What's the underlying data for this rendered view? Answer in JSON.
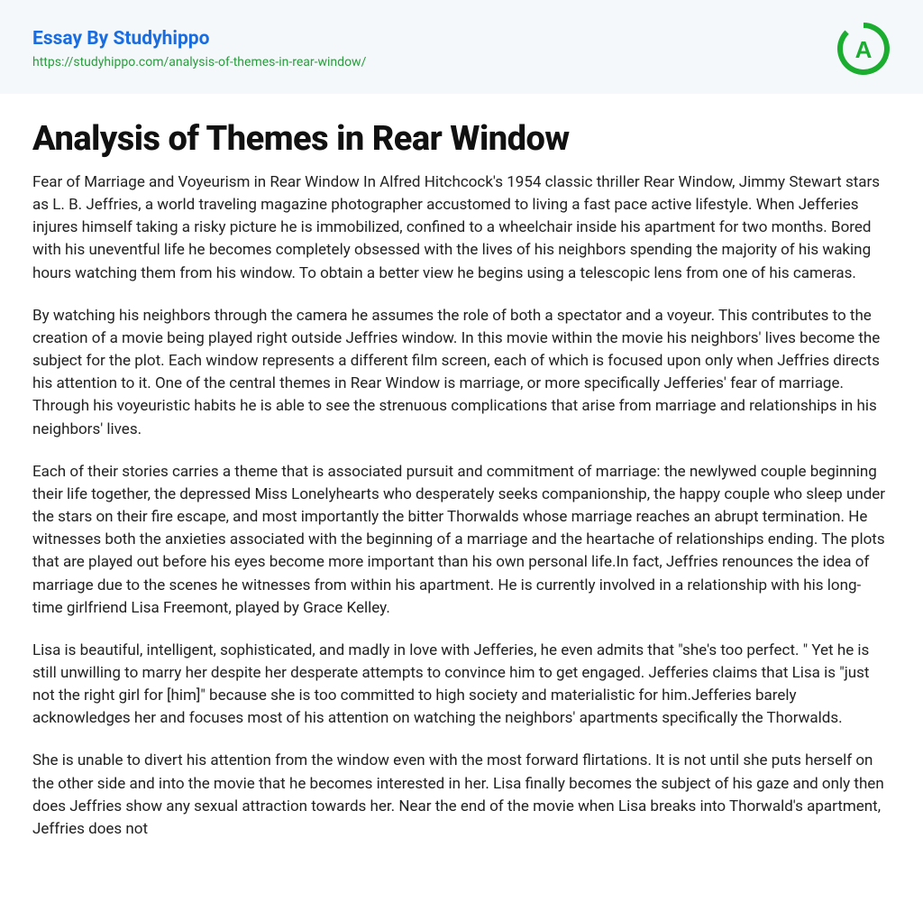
{
  "header": {
    "site_title": "Essay By Studyhippo",
    "url": "https://studyhippo.com/analysis-of-themes-in-rear-window/",
    "logo_letter": "A"
  },
  "essay": {
    "title": "Analysis of Themes in Rear Window",
    "paragraphs": [
      "Fear of Marriage and Voyeurism in Rear Window In Alfred Hitchcock's 1954 classic thriller Rear Window, Jimmy Stewart stars as L. B. Jeffries, a world traveling magazine photographer accustomed to living a fast pace active lifestyle. When Jefferies injures himself taking a risky picture he is immobilized, confined to a wheelchair inside his apartment for two months. Bored with his uneventful life he becomes completely obsessed with the lives of his neighbors spending the majority of his waking hours watching them from his window. To obtain a better view he begins using a telescopic lens from one of his cameras.",
      "By watching his neighbors through the camera he assumes the role of both a spectator and a voyeur. This contributes to the creation of a movie being played right outside Jeffries window. In this movie within the movie his neighbors' lives become the subject for the plot. Each window represents a different film screen, each of which is focused upon only when Jeffries directs his attention to it. One of the central themes in Rear Window is marriage, or more specifically Jefferies' fear of marriage. Through his voyeuristic habits he is able to see the strenuous complications that arise from marriage and relationships in his neighbors' lives.",
      "Each of their stories carries a theme that is associated pursuit and commitment of marriage: the newlywed couple beginning their life together, the depressed Miss Lonelyhearts who desperately seeks companionship, the happy couple who sleep under the stars on their fire escape, and most importantly the bitter Thorwalds whose marriage reaches an abrupt termination. He witnesses both the anxieties associated with the beginning of a marriage and the heartache of relationships ending. The plots that are played out before his eyes become more important than his own personal life.In fact, Jeffries renounces the idea of marriage due to the scenes he witnesses from within his apartment. He is currently involved in a relationship with his long-time girlfriend Lisa Freemont, played by Grace Kelley.",
      "Lisa is beautiful, intelligent, sophisticated, and madly in love with Jefferies, he even admits that \"she's too perfect. \" Yet he is still unwilling to marry her despite her desperate attempts to convince him to get engaged. Jefferies claims that Lisa is \"just not the right girl for [him]\" because she is too committed to high society and materialistic for him.Jefferies barely acknowledges her and focuses most of his attention on watching the neighbors' apartments specifically the Thorwalds.",
      "She is unable to divert his attention from the window even with the most forward flirtations. It is not until she puts herself on the other side and into the movie that he becomes interested in her. Lisa finally becomes the subject of his gaze and only then does Jeffries show any sexual attraction towards her. Near the end of the movie when Lisa breaks into Thorwald's apartment, Jeffries does not"
    ]
  }
}
